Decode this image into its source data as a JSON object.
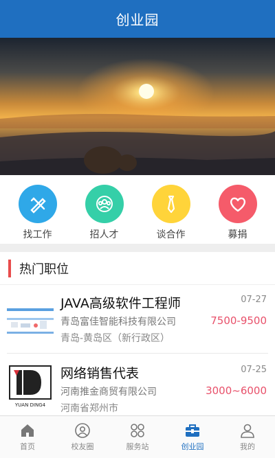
{
  "header": {
    "title": "创业园"
  },
  "quick_actions": [
    {
      "label": "找工作",
      "icon": "pencil-ruler-icon",
      "color": "#2fa8e8"
    },
    {
      "label": "招人才",
      "icon": "team-icon",
      "color": "#35cfa8"
    },
    {
      "label": "谈合作",
      "icon": "tie-icon",
      "color": "#ffd43a"
    },
    {
      "label": "募捐",
      "icon": "heart-icon",
      "color": "#f55b6a"
    }
  ],
  "section": {
    "title": "热门职位"
  },
  "jobs": [
    {
      "title": "JAVA高级软件工程师",
      "date": "07-27",
      "company": "青岛富佳智能科技有限公司",
      "salary": "7500-9500",
      "area": "青岛-黄岛区（新行政区）"
    },
    {
      "title": "网络销售代表",
      "date": "07-25",
      "company": "河南推金商贸有限公司",
      "salary": "3000~6000",
      "area": "河南省郑州市",
      "logo_text": "YUAN DING4"
    }
  ],
  "tabs": [
    {
      "label": "首页",
      "icon": "home-icon"
    },
    {
      "label": "校友圈",
      "icon": "alumni-icon"
    },
    {
      "label": "服务站",
      "icon": "grid-icon"
    },
    {
      "label": "创业园",
      "icon": "briefcase-icon",
      "active": true
    },
    {
      "label": "我的",
      "icon": "user-icon"
    }
  ],
  "colors": {
    "primary": "#1f6fc0",
    "accent_red": "#e84c4c",
    "salary": "#e8506a"
  }
}
